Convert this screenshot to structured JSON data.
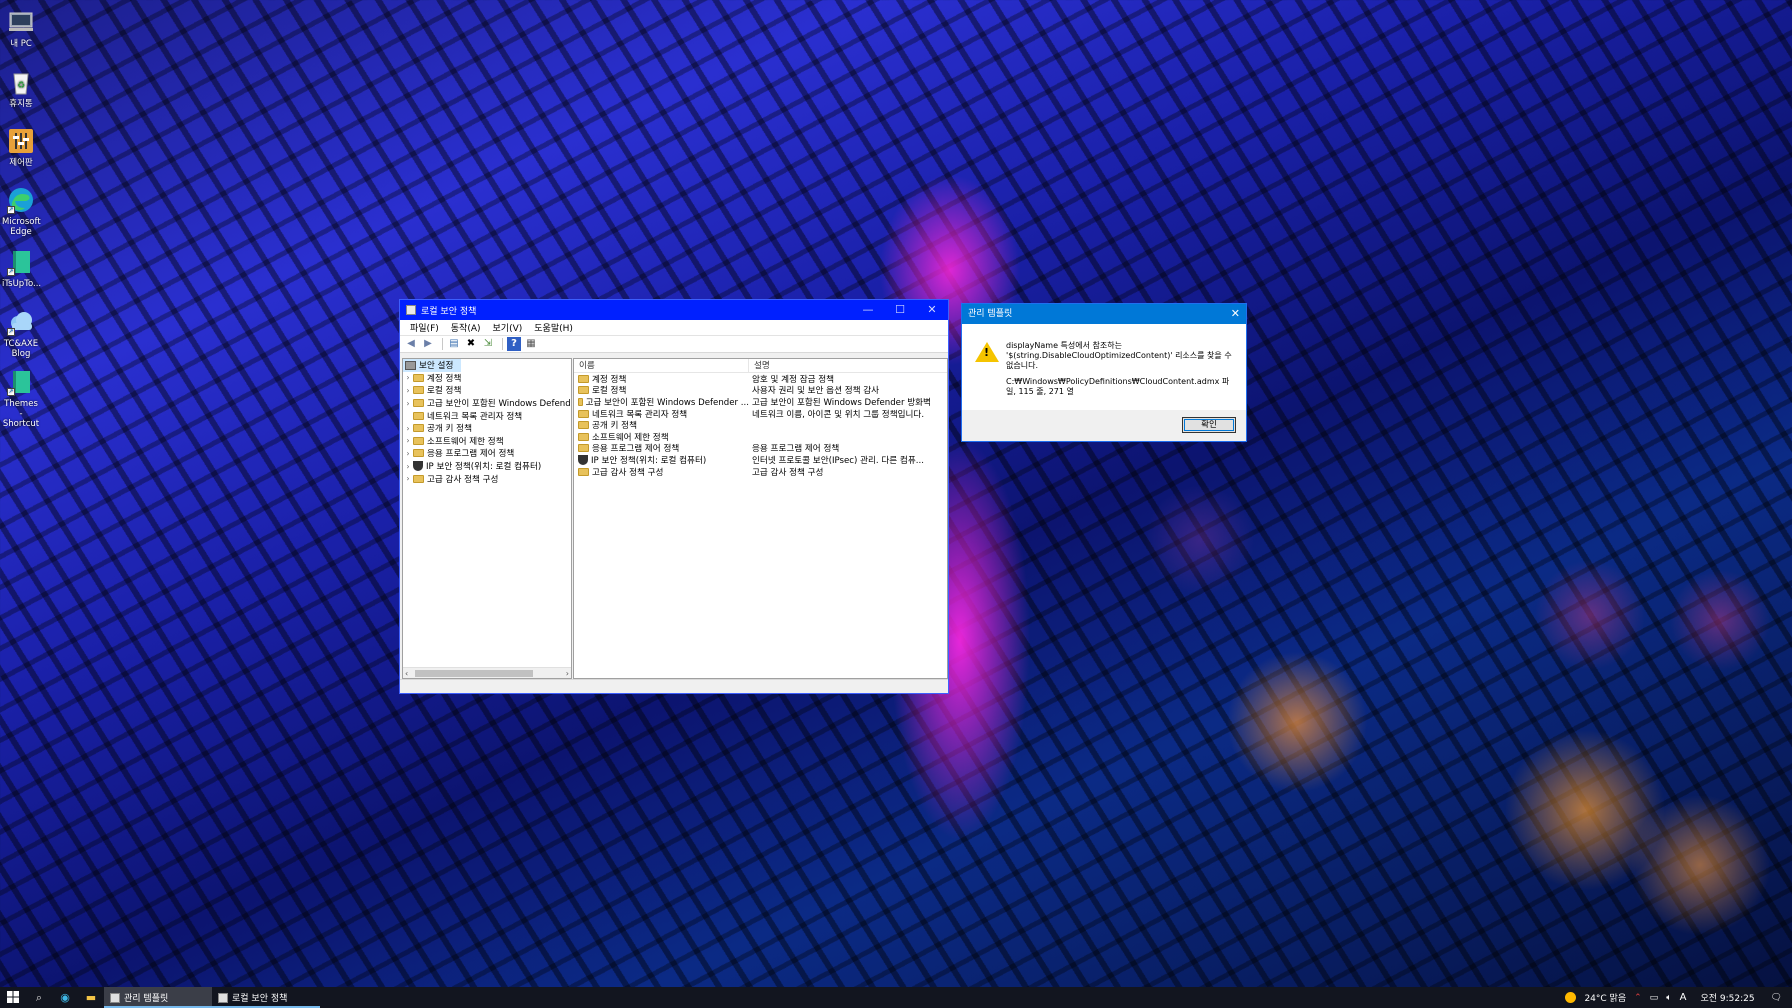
{
  "desktop": {
    "icons": [
      {
        "label": "내 PC",
        "icon": "computer-icon"
      },
      {
        "label": "휴지통",
        "icon": "recycle-bin-icon"
      },
      {
        "label": "제어판",
        "icon": "control-panel-icon"
      },
      {
        "label": "Microsoft Edge",
        "icon": "edge-icon"
      },
      {
        "label": "iTsUpTo...",
        "icon": "book-icon"
      },
      {
        "label": "TC&AXE Blog",
        "icon": "cloud-icon"
      },
      {
        "label": "Themes - Shortcut",
        "icon": "book-icon"
      }
    ]
  },
  "main_window": {
    "title": "로컬 보안 정책",
    "menu": [
      "파일(F)",
      "동작(A)",
      "보기(V)",
      "도움말(H)"
    ],
    "tree": {
      "root": "보안 설정",
      "items": [
        "계정 정책",
        "로컬 정책",
        "고급 보안이 포함된 Windows Defend",
        "네트워크 목록 관리자 정책",
        "공개 키 정책",
        "소프트웨어 제한 정책",
        "응용 프로그램 제어 정책",
        "IP 보안 정책(위치: 로컬 컴퓨터)",
        "고급 감사 정책 구성"
      ]
    },
    "list": {
      "columns": [
        "이름",
        "설명"
      ],
      "rows": [
        {
          "name": "계정 정책",
          "desc": "암호 및 계정 잠금 정책"
        },
        {
          "name": "로컬 정책",
          "desc": "사용자 권리 및 보안 옵션 정책 감사"
        },
        {
          "name": "고급 보안이 포함된 Windows Defender ...",
          "desc": "고급 보안이 포함된 Windows Defender 방화벽"
        },
        {
          "name": "네트워크 목록 관리자 정책",
          "desc": "네트워크 이름, 아이콘 및 위치 그룹 정책입니다."
        },
        {
          "name": "공개 키 정책",
          "desc": ""
        },
        {
          "name": "소프트웨어 제한 정책",
          "desc": ""
        },
        {
          "name": "응용 프로그램 제어 정책",
          "desc": "응용 프로그램 제어 정책"
        },
        {
          "name": "IP 보안 정책(위치: 로컬 컴퓨터)",
          "desc": "인터넷 프로토콜 보안(IPsec) 관리. 다른 컴퓨..."
        },
        {
          "name": "고급 감사 정책 구성",
          "desc": "고급 감사 정책 구성"
        }
      ]
    }
  },
  "dialog": {
    "title": "관리 템플릿",
    "message_line1": "displayName 특성에서 참조하는 '$(string.DisableCloudOptimizedContent)' 리소스를 찾을 수 없습니다.",
    "message_line2": "C:₩Windows₩PolicyDefinitions₩CloudContent.admx 파일, 115 줄, 271 열",
    "ok_label": "확인"
  },
  "taskbar": {
    "tasks": [
      "관리 템플릿",
      "로컬 보안 정책"
    ],
    "weather": "24°C 맑음",
    "ime": "A",
    "clock": "오전 9:52:25"
  }
}
